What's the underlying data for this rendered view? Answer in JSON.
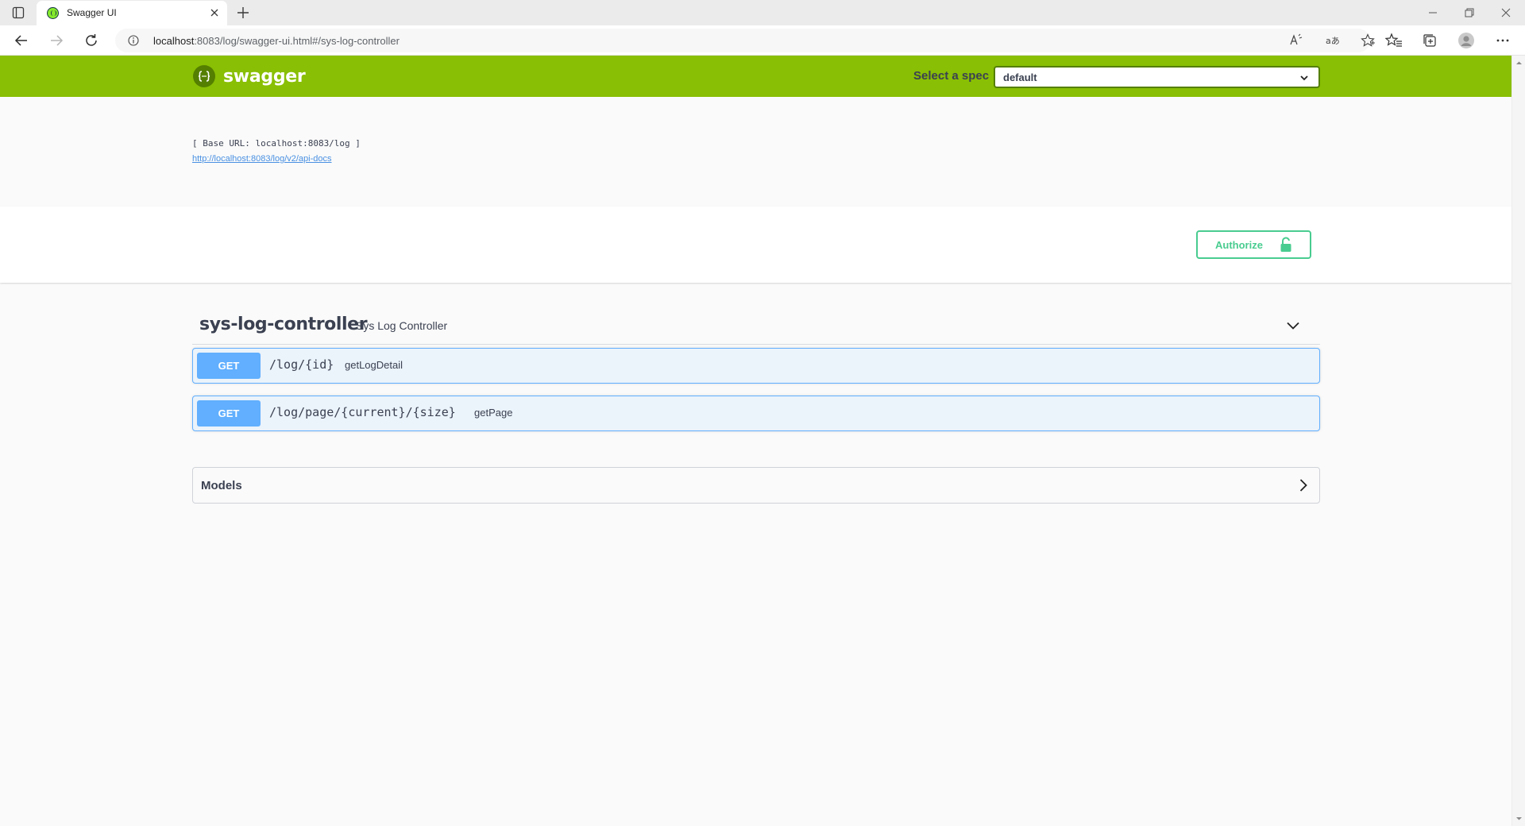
{
  "browser": {
    "tab_title": "Swagger UI",
    "url_host": "localhost",
    "url_rest": ":8083/log/swagger-ui.html#/sys-log-controller"
  },
  "swagger": {
    "logo_text": "swagger",
    "spec_label": "Select a spec",
    "spec_value": "default",
    "base_url": "[ Base URL: localhost:8083/log ]",
    "api_docs_link": "http://localhost:8083/log/v2/api-docs",
    "authorize_label": "Authorize"
  },
  "tag": {
    "name": "sys-log-controller",
    "description": "Sys Log Controller"
  },
  "operations": [
    {
      "method": "GET",
      "path": "/log/{id}",
      "summary": "getLogDetail"
    },
    {
      "method": "GET",
      "path": "/log/page/{current}/{size}",
      "summary": "getPage"
    }
  ],
  "models": {
    "title": "Models"
  },
  "colors": {
    "topbar": "#89bf04",
    "get_method": "#61affe",
    "get_bg": "#ebf3fb",
    "authorize": "#49cc90"
  }
}
